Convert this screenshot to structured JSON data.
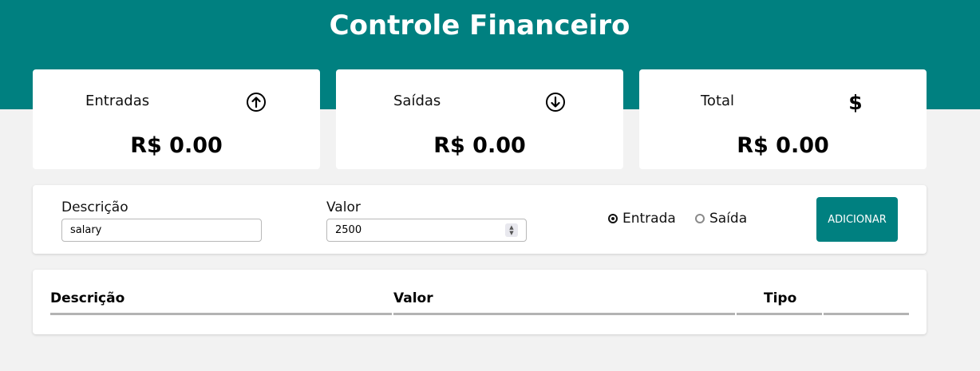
{
  "header": {
    "title": "Controle Financeiro",
    "background": "#008080"
  },
  "summary": {
    "income": {
      "label": "Entradas",
      "value": "R$ 0.00",
      "icon": "arrow-up-circle-icon"
    },
    "expenses": {
      "label": "Saídas",
      "value": "R$ 0.00",
      "icon": "arrow-down-circle-icon"
    },
    "total": {
      "label": "Total",
      "value": "R$ 0.00",
      "icon": "dollar-sign-icon"
    }
  },
  "form": {
    "description_label": "Descrição",
    "description_value": "salary",
    "amount_label": "Valor",
    "amount_value": "2500",
    "type_options": [
      {
        "label": "Entrada",
        "selected": true
      },
      {
        "label": "Saída",
        "selected": false
      }
    ],
    "add_button_label": "ADICIONAR",
    "accent": "#008080"
  },
  "table": {
    "columns": [
      "Descrição",
      "Valor",
      "Tipo",
      ""
    ],
    "rows": []
  }
}
